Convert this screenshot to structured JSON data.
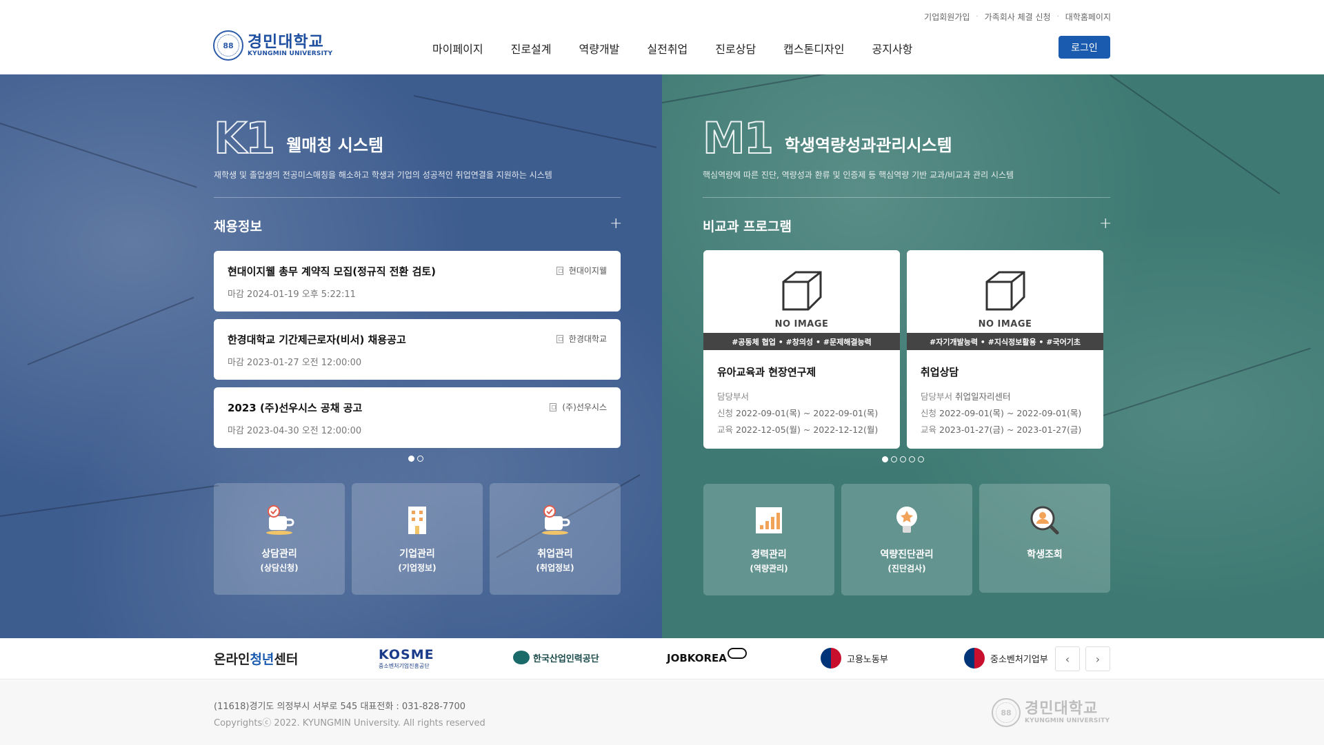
{
  "header": {
    "util_links": [
      "기업회원가입",
      "가족회사 체결 신청",
      "대학홈페이지"
    ],
    "logo_ko": "경민대학교",
    "logo_en": "KYUNGMIN UNIVERSITY",
    "nav": [
      "마이페이지",
      "진로설계",
      "역량개발",
      "실전취업",
      "진로상담",
      "캡스톤디자인",
      "공지사항"
    ],
    "login_label": "로그인"
  },
  "left": {
    "code": "K1",
    "name": "웰매칭 시스템",
    "desc": "재학생 및 졸업생의 전공미스매칭을 해소하고 학생과 기업의 성공적인 취업연결을 지원하는 시스템",
    "section_title": "채용정보",
    "jobs": [
      {
        "title": "현대이지웰 총무 계약직 모집(정규직 전환 검토)",
        "company": "현대이지웰",
        "deadline": "마감 2024-01-19 오후 5:22:11"
      },
      {
        "title": "한경대학교 기간제근로자(비서) 채용공고",
        "company": "한경대학교",
        "deadline": "마감 2023-01-27 오전 12:00:00"
      },
      {
        "title": "2023 (주)선우시스 공채 공고",
        "company": "(주)선우시스",
        "deadline": "마감 2023-04-30 오전 12:00:00"
      }
    ],
    "tiles": [
      {
        "label": "상담관리",
        "sub": "(상담신청)",
        "icon": "coffee-cup-icon"
      },
      {
        "label": "기업관리",
        "sub": "(기업정보)",
        "icon": "building-icon"
      },
      {
        "label": "취업관리",
        "sub": "(취업정보)",
        "icon": "coffee-cup-icon"
      }
    ]
  },
  "right": {
    "code": "M1",
    "name": "학생역량성과관리시스템",
    "desc": "핵심역량에 따른 진단, 역량성과 환류 및 인증제 등 핵심역량 기반 교과/비교과 관리 시스템",
    "section_title": "비교과 프로그램",
    "programs": [
      {
        "noimg": "NO IMAGE",
        "tags": "#공동체 협업  •  #창의성  •  #문제해결능력",
        "title": "유아교육과 현장연구제",
        "dept_label": "담당부서",
        "dept": "",
        "apply_label": "신청",
        "apply": "2022-09-01(목) ~ 2022-09-01(목)",
        "edu_label": "교육",
        "edu": "2022-12-05(월) ~ 2022-12-12(월)"
      },
      {
        "noimg": "NO IMAGE",
        "tags": "#자기개발능력  •  #지식정보활용  •  #국어기초",
        "title": "취업상담",
        "dept_label": "담당부서",
        "dept": "취업일자리센터",
        "apply_label": "신청",
        "apply": "2022-09-01(목) ~ 2022-09-01(목)",
        "edu_label": "교육",
        "edu": "2023-01-27(금) ~ 2023-01-27(금)"
      }
    ],
    "tiles": [
      {
        "label": "경력관리",
        "sub": "(역량관리)",
        "icon": "bar-chart-icon"
      },
      {
        "label": "역량진단관리",
        "sub": "(진단검사)",
        "icon": "lightbulb-icon"
      },
      {
        "label": "학생조회",
        "sub": "",
        "icon": "person-search-icon"
      }
    ]
  },
  "partners": {
    "online_pre": "온라인 ",
    "online_hl": "청년",
    "online_post": " 센터",
    "kosme": "KOSME",
    "kosme_sub": "중소벤처기업진흥공단",
    "hrdk": "한국산업인력공단",
    "jobkorea": "JOBKOREA",
    "moel": "고용노동부",
    "mss": "중소벤처기업부"
  },
  "footer": {
    "address": "(11618)경기도 의정부시 서부로 545 대표전화 : 031-828-7700",
    "copyright": "Copyrightsⓒ 2022. KYUNGMIN University. All rights reserved",
    "logo_ko": "경민대학교",
    "logo_en": "KYUNGMIN UNIVERSITY"
  },
  "colors": {
    "left_bg": "#3e5d8f",
    "right_bg": "#3e7a73",
    "accent": "#1a5bb0"
  }
}
